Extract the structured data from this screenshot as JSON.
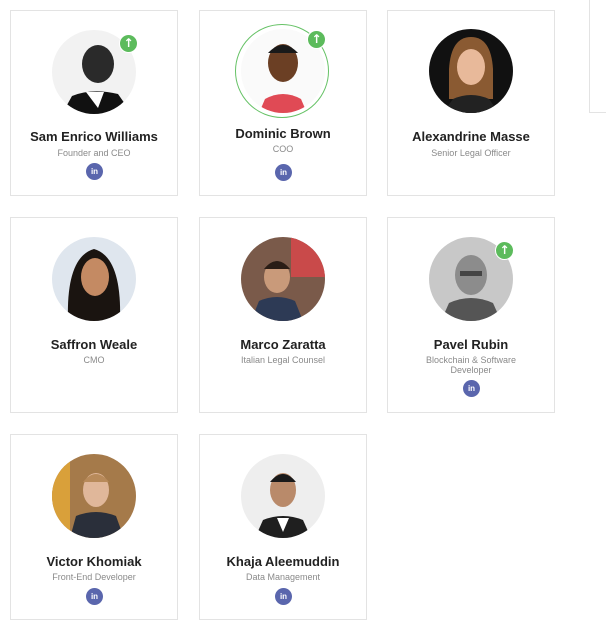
{
  "members": [
    {
      "name": "Sam Enrico Williams",
      "role": "Founder and CEO",
      "linkedin": "in"
    },
    {
      "name": "Dominic Brown",
      "role": "COO",
      "linkedin": "in"
    },
    {
      "name": "Alexandrine Masse",
      "role": "Senior Legal Officer"
    },
    {
      "name": "Saffron Weale",
      "role": "CMO"
    },
    {
      "name": "Marco Zaratta",
      "role": "Italian Legal Counsel"
    },
    {
      "name": "Pavel Rubin",
      "role_line1": "Blockchain & Software",
      "role_line2": "Developer",
      "linkedin": "in"
    },
    {
      "name": "Victor Khomiak",
      "role": "Front-End Developer",
      "linkedin": "in"
    },
    {
      "name": "Khaja Aleemuddin",
      "role": "Data Management",
      "linkedin": "in"
    }
  ],
  "badge_icon": "arrow-up-icon",
  "badge_symbol": "↑",
  "colors": {
    "badge": "#5cbb5c",
    "linkedin": "#5a66ad",
    "ring": "#66c266"
  }
}
